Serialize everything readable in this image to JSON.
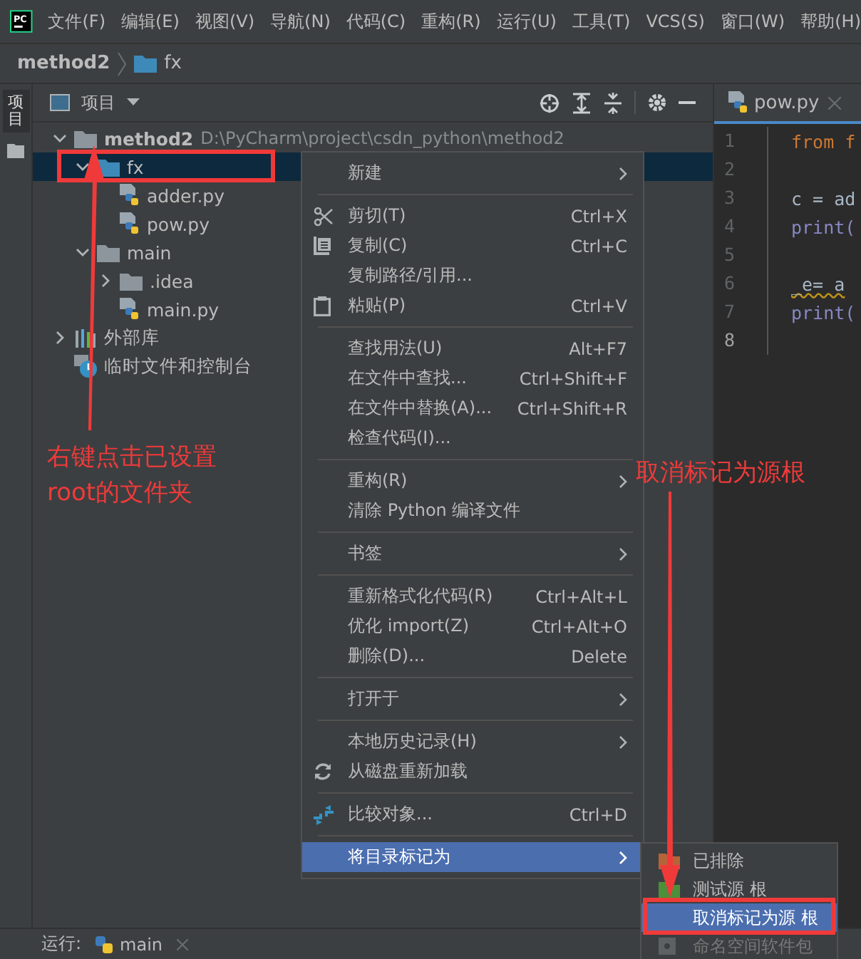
{
  "logo": "PC",
  "menu_bar": [
    "文件(F)",
    "编辑(E)",
    "视图(V)",
    "导航(N)",
    "代码(C)",
    "重构(R)",
    "运行(U)",
    "工具(T)",
    "VCS(S)",
    "窗口(W)",
    "帮助(H)"
  ],
  "breadcrumb": {
    "project": "method2",
    "folder": "fx"
  },
  "side_strip": {
    "label": "项目"
  },
  "project_panel": {
    "title": "项目",
    "tree": [
      {
        "name": "method2",
        "path": "D:\\PyCharm\\project\\csdn_python\\method2",
        "kind": "folder",
        "expanded": true,
        "selected": false,
        "children": [
          {
            "name": "fx",
            "kind": "source-folder",
            "expanded": true,
            "selected": true,
            "children": [
              {
                "name": "adder.py",
                "kind": "python",
                "selected": false
              },
              {
                "name": "pow.py",
                "kind": "python",
                "selected": false
              }
            ]
          },
          {
            "name": "main",
            "kind": "folder",
            "expanded": true,
            "selected": false,
            "children": [
              {
                "name": ".idea",
                "kind": "folder",
                "expanded": false,
                "selected": false
              },
              {
                "name": "main.py",
                "kind": "python",
                "selected": false
              }
            ]
          }
        ]
      },
      {
        "name": "外部库",
        "kind": "library",
        "expanded": false,
        "selected": false
      },
      {
        "name": "临时文件和控制台",
        "kind": "scratch",
        "selected": false
      }
    ]
  },
  "editor": {
    "tab": "pow.py",
    "lines": [
      {
        "number": "1",
        "code": "from f",
        "kind": "keyword"
      },
      {
        "number": "2",
        "kind": "plain"
      },
      {
        "number": "3",
        "code": "c = ad",
        "kind": "plain"
      },
      {
        "number": "4",
        "code": "print(",
        "kind": "call"
      },
      {
        "number": "5",
        "kind": "plain"
      },
      {
        "number": "6",
        "code": "_e= a",
        "kind": "warning"
      },
      {
        "number": "7",
        "code": "print(",
        "kind": "call"
      },
      {
        "number": "8",
        "kind": "current"
      }
    ]
  },
  "context_menu": [
    {
      "kind": "item",
      "label": "新建",
      "submenu": true,
      "selected": false
    },
    {
      "kind": "separator"
    },
    {
      "kind": "item",
      "label": "剪切(T)",
      "shortcut": "Ctrl+X",
      "submenu": false,
      "selected": false
    },
    {
      "kind": "item",
      "label": "复制(C)",
      "shortcut": "Ctrl+C",
      "submenu": false,
      "selected": false
    },
    {
      "kind": "item",
      "label": "复制路径/引用...",
      "submenu": false,
      "selected": false
    },
    {
      "kind": "item",
      "label": "粘贴(P)",
      "shortcut": "Ctrl+V",
      "submenu": false,
      "selected": false
    },
    {
      "kind": "separator"
    },
    {
      "kind": "item",
      "label": "查找用法(U)",
      "shortcut": "Alt+F7",
      "submenu": false,
      "selected": false
    },
    {
      "kind": "item",
      "label": "在文件中查找...",
      "shortcut": "Ctrl+Shift+F",
      "submenu": false,
      "selected": false
    },
    {
      "kind": "item",
      "label": "在文件中替换(A)...",
      "shortcut": "Ctrl+Shift+R",
      "submenu": false,
      "selected": false
    },
    {
      "kind": "item",
      "label": "检查代码(I)...",
      "submenu": false,
      "selected": false
    },
    {
      "kind": "separator"
    },
    {
      "kind": "item",
      "label": "重构(R)",
      "submenu": true,
      "selected": false
    },
    {
      "kind": "item",
      "label": "清除 Python 编译文件",
      "submenu": false,
      "selected": false
    },
    {
      "kind": "separator"
    },
    {
      "kind": "item",
      "label": "书签",
      "submenu": true,
      "selected": false
    },
    {
      "kind": "separator"
    },
    {
      "kind": "item",
      "label": "重新格式化代码(R)",
      "shortcut": "Ctrl+Alt+L",
      "submenu": false,
      "selected": false
    },
    {
      "kind": "item",
      "label": "优化 import(Z)",
      "shortcut": "Ctrl+Alt+O",
      "submenu": false,
      "selected": false
    },
    {
      "kind": "item",
      "label": "删除(D)...",
      "shortcut": "Delete",
      "submenu": false,
      "selected": false
    },
    {
      "kind": "separator"
    },
    {
      "kind": "item",
      "label": "打开于",
      "submenu": true,
      "selected": false
    },
    {
      "kind": "separator"
    },
    {
      "kind": "item",
      "label": "本地历史记录(H)",
      "submenu": true,
      "selected": false
    },
    {
      "kind": "item",
      "label": "从磁盘重新加载",
      "submenu": false,
      "selected": false
    },
    {
      "kind": "separator"
    },
    {
      "kind": "item",
      "label": "比较对象...",
      "shortcut": "Ctrl+D",
      "submenu": false,
      "selected": false
    },
    {
      "kind": "separator"
    },
    {
      "kind": "item",
      "label": "将目录标记为",
      "submenu": true,
      "selected": true
    }
  ],
  "submenu": [
    {
      "kind": "folder",
      "label": "已排除",
      "color": "#b5643a",
      "selected": false,
      "disabled": false
    },
    {
      "kind": "folder",
      "label": "测试源 根",
      "color": "#4e8f3a",
      "selected": false,
      "disabled": false
    },
    {
      "kind": "plain",
      "label": "取消标记为源 根",
      "selected": true,
      "disabled": false
    },
    {
      "kind": "package",
      "label": "命名空间软件包",
      "selected": false,
      "disabled": true
    }
  ],
  "annotations": [
    {
      "text": "右键点击已设置root的文件夹"
    },
    {
      "text": "取消标记为源根"
    }
  ],
  "bottom_bar": {
    "label": "运行:",
    "tab": "main"
  }
}
